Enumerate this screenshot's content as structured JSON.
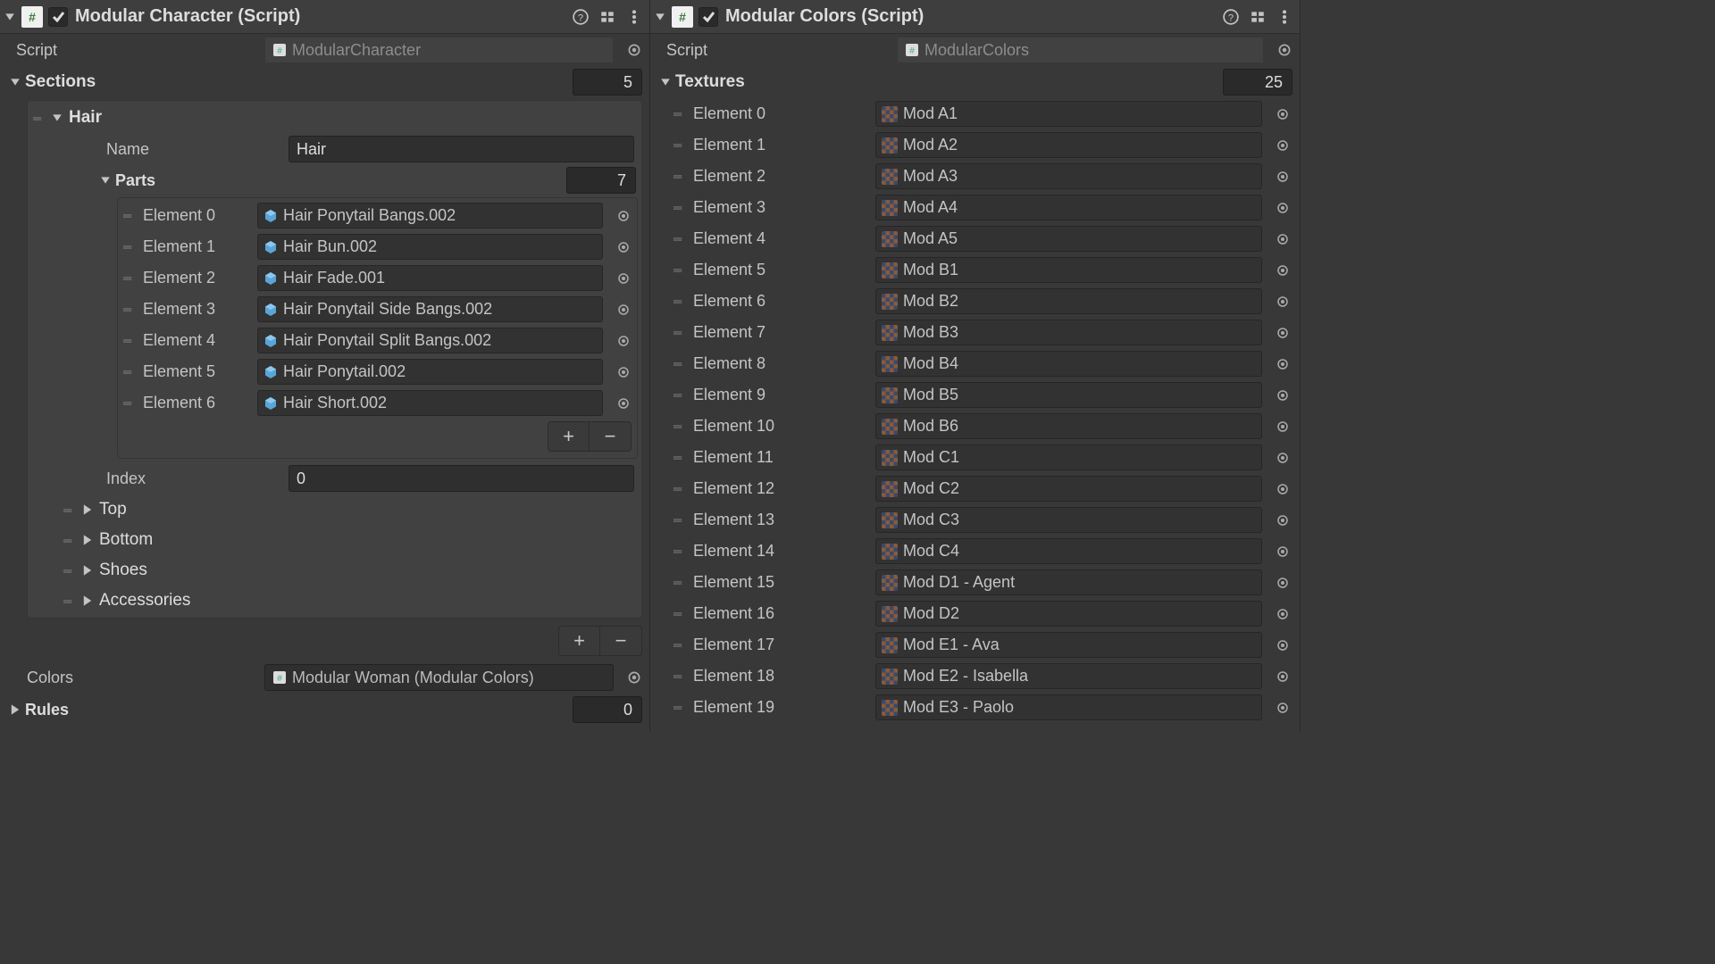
{
  "left": {
    "title": "Modular Character (Script)",
    "scriptLabel": "Script",
    "scriptValue": "ModularCharacter",
    "sectionsLabel": "Sections",
    "sectionsCount": "5",
    "hair": {
      "header": "Hair",
      "nameLabel": "Name",
      "nameValue": "Hair",
      "partsLabel": "Parts",
      "partsCount": "7",
      "elements": [
        {
          "idx": "Element 0",
          "val": "Hair Ponytail Bangs.002"
        },
        {
          "idx": "Element 1",
          "val": "Hair Bun.002"
        },
        {
          "idx": "Element 2",
          "val": "Hair Fade.001"
        },
        {
          "idx": "Element 3",
          "val": "Hair Ponytail Side Bangs.002"
        },
        {
          "idx": "Element 4",
          "val": "Hair Ponytail Split Bangs.002"
        },
        {
          "idx": "Element 5",
          "val": "Hair Ponytail.002"
        },
        {
          "idx": "Element 6",
          "val": "Hair Short.002"
        }
      ],
      "indexLabel": "Index",
      "indexValue": "0"
    },
    "collapsed": [
      "Top",
      "Bottom",
      "Shoes",
      "Accessories"
    ],
    "colorsLabel": "Colors",
    "colorsValue": "Modular Woman (Modular Colors)",
    "rulesLabel": "Rules",
    "rulesCount": "0"
  },
  "right": {
    "title": "Modular Colors (Script)",
    "scriptLabel": "Script",
    "scriptValue": "ModularColors",
    "texturesLabel": "Textures",
    "texturesCount": "25",
    "elements": [
      {
        "idx": "Element 0",
        "val": "Mod A1"
      },
      {
        "idx": "Element 1",
        "val": "Mod A2"
      },
      {
        "idx": "Element 2",
        "val": "Mod A3"
      },
      {
        "idx": "Element 3",
        "val": "Mod A4"
      },
      {
        "idx": "Element 4",
        "val": "Mod A5"
      },
      {
        "idx": "Element 5",
        "val": "Mod B1"
      },
      {
        "idx": "Element 6",
        "val": "Mod B2"
      },
      {
        "idx": "Element 7",
        "val": "Mod B3"
      },
      {
        "idx": "Element 8",
        "val": "Mod B4"
      },
      {
        "idx": "Element 9",
        "val": "Mod B5"
      },
      {
        "idx": "Element 10",
        "val": "Mod B6"
      },
      {
        "idx": "Element 11",
        "val": "Mod C1"
      },
      {
        "idx": "Element 12",
        "val": "Mod C2"
      },
      {
        "idx": "Element 13",
        "val": "Mod C3"
      },
      {
        "idx": "Element 14",
        "val": "Mod C4"
      },
      {
        "idx": "Element 15",
        "val": "Mod D1 - Agent"
      },
      {
        "idx": "Element 16",
        "val": "Mod D2"
      },
      {
        "idx": "Element 17",
        "val": "Mod E1 - Ava"
      },
      {
        "idx": "Element 18",
        "val": "Mod E2 - Isabella"
      },
      {
        "idx": "Element 19",
        "val": "Mod E3 - Paolo"
      }
    ]
  }
}
